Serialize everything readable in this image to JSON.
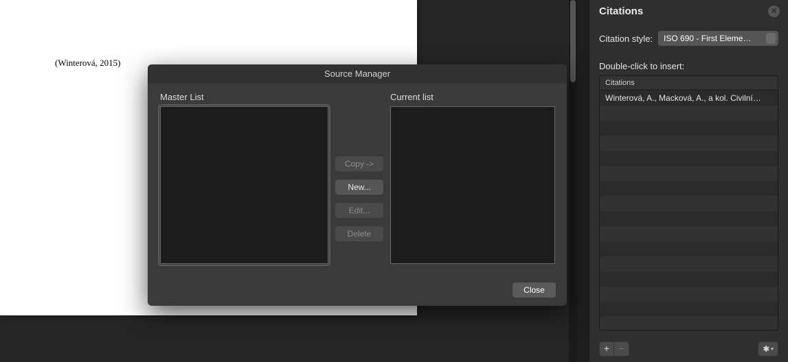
{
  "document": {
    "citation_text": "(Winterová, 2015)"
  },
  "dialog": {
    "title": "Source Manager",
    "master_label": "Master List",
    "current_label": "Current list",
    "buttons": {
      "copy": "Copy ->",
      "new": "New...",
      "edit": "Edit...",
      "delete": "Delete"
    },
    "close": "Close"
  },
  "panel": {
    "title": "Citations",
    "style_label": "Citation style:",
    "style_value": "ISO 690 - First Eleme…",
    "insert_label": "Double-click to insert:",
    "table_header": "Citations",
    "rows": [
      "Winterová, A., Macková, A., a kol. Civilní…"
    ],
    "footer": {
      "add": "+",
      "remove": "−",
      "gear": "✱"
    }
  }
}
